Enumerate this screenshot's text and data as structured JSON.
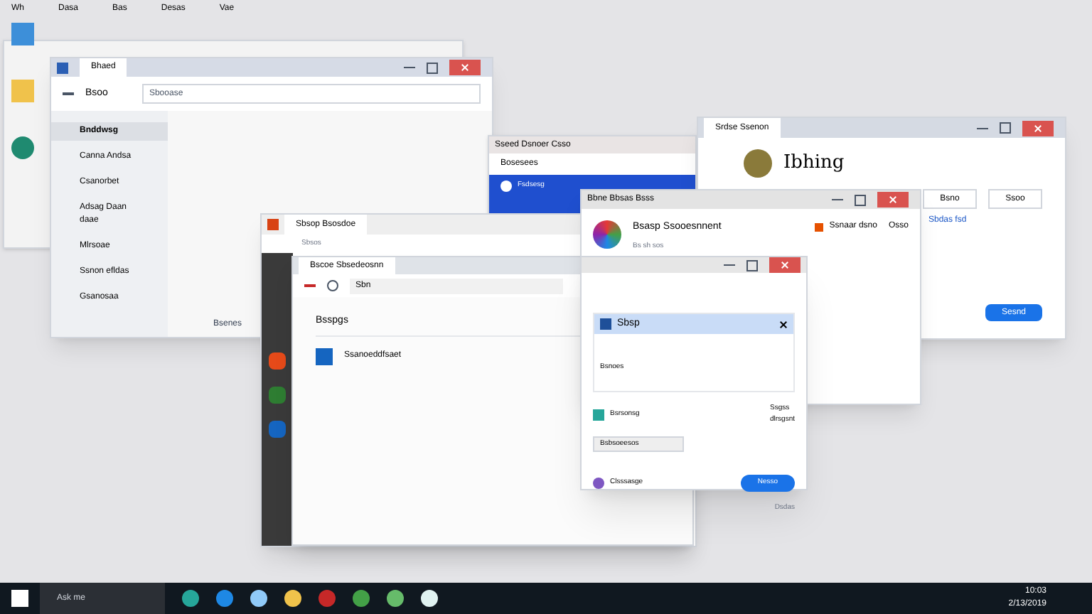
{
  "desktop_menu": [
    "Wh",
    "Dasa",
    "Bas",
    "Desas",
    "Vae"
  ],
  "explorer": {
    "tab": "Bhaed",
    "location": "Bsoo",
    "address": "Sbooase",
    "sidebar": [
      {
        "label": "Bnddwsg",
        "selected": true
      },
      {
        "label": "Canna Andsa",
        "selected": false
      },
      {
        "label": "Csanorbet",
        "selected": false
      },
      {
        "label": "Adsag Daan daae",
        "selected": false
      },
      {
        "label": "Mlrsoae",
        "selected": false
      },
      {
        "label": "Ssnon efldas",
        "selected": false
      },
      {
        "label": "Gsanosaa",
        "selected": false
      }
    ],
    "status": "Bsenes"
  },
  "mail_window": {
    "title": "Sseed Dsnoer Csso",
    "header": "Bosesees",
    "item": "Fsdsesg"
  },
  "profile_window": {
    "tab": "Srdse Ssenon",
    "name": "Ibhing",
    "buttons": [
      "Bsno",
      "Ssoo"
    ],
    "link": "Sbdas fsd",
    "action": "Sesnd"
  },
  "account_window": {
    "title": "Bbne Bbsas Bsss",
    "heading": "Bsasp Ssooesnnent",
    "subtitle": "Bs sh sos",
    "shortcut": "Ssnaar dsno",
    "menu": "Osso"
  },
  "back_browser": {
    "tab": "Sbsop Bsosdoe",
    "address": "Sbsos"
  },
  "front_browser": {
    "tabs": [
      {
        "label": "Bscoe Sbsedeosnn",
        "selected": true
      }
    ],
    "address": "Sbn",
    "heading": "Bsspgs",
    "item": "Ssanoeddfsaet"
  },
  "dialog": {
    "card_title": "Sbsp",
    "card_body": "Bsnoes",
    "option": "Bsrsonsg",
    "note_title": "Ssgss",
    "note_body": "dlrsgsnt",
    "dropdown": "Bsbsoeesos",
    "account": "Clsssasge",
    "button": "Nesso",
    "footer": "Dsdas"
  },
  "taskbar": {
    "search": "Ask me",
    "time": "10:03",
    "date": "2/13/2019"
  }
}
